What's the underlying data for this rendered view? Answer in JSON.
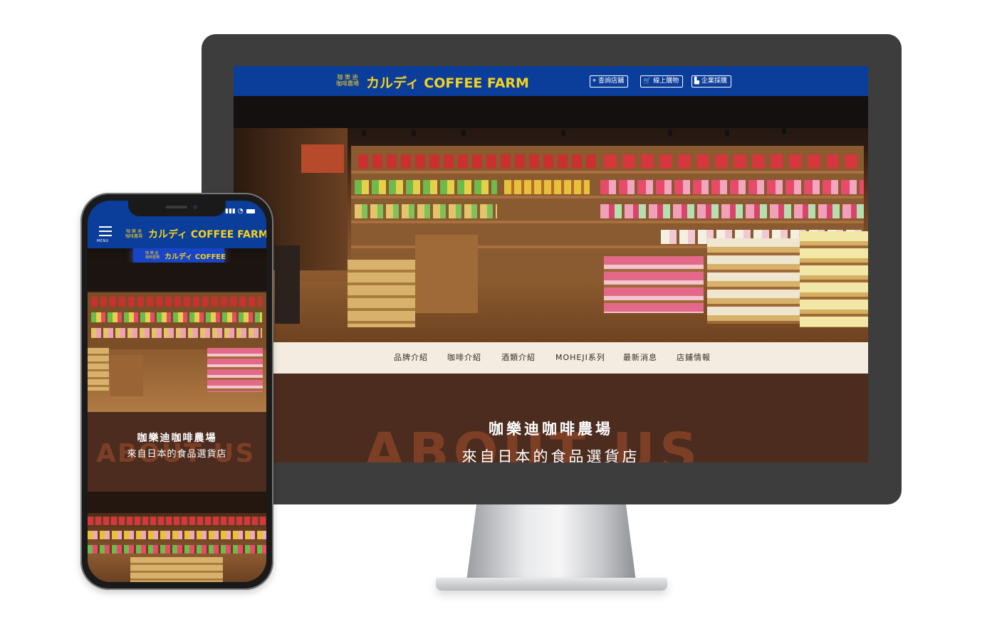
{
  "brand": {
    "logo_small_line1": "咖 樂 迪",
    "logo_small_line2": "咖啡農場",
    "logo_main": "カルディ COFFEE FARM",
    "sign_coffee": "COFFEE",
    "sign_farm": "FARM",
    "color_primary": "#0b3d9a",
    "color_logo": "#f4d21e",
    "color_about_bg": "#4b2c1f",
    "color_nav_bg": "#f4ece1"
  },
  "desktop": {
    "header_buttons": [
      {
        "label": "查詢店舖",
        "icon": "location-pin-icon"
      },
      {
        "label": "線上購物",
        "icon": "cart-icon"
      },
      {
        "label": "企業採購",
        "icon": "building-icon"
      }
    ],
    "nav": [
      "品牌介紹",
      "咖啡介紹",
      "酒類介紹",
      "MOHEJI系列",
      "最新消息",
      "店鋪情報"
    ],
    "about": {
      "bg_text": "ABOUT US",
      "title": "咖樂迪咖啡農場",
      "subtitle": "來自日本的食品選貨店"
    }
  },
  "mobile": {
    "menu_label": "MENU",
    "status": "▮▮▮ ◔",
    "about": {
      "bg_text": "ABOUT US",
      "title": "咖樂迪咖啡農場",
      "subtitle": "來自日本的食品選貨店"
    }
  }
}
